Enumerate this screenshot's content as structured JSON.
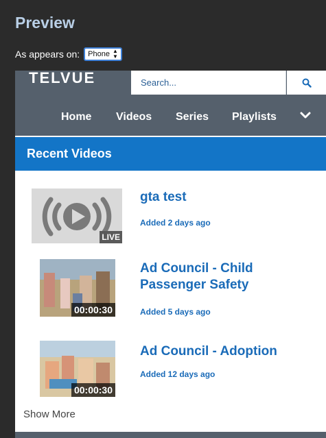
{
  "header": {
    "title": "Preview"
  },
  "device": {
    "label": "As appears on:",
    "selected": "Phone"
  },
  "site": {
    "logo": "TELVUE",
    "search_placeholder": "Search...",
    "nav": [
      "Home",
      "Videos",
      "Series",
      "Playlists"
    ]
  },
  "section": {
    "title": "Recent Videos"
  },
  "videos": [
    {
      "title": "gta test",
      "added": "Added 2 days ago",
      "badge": "LIVE"
    },
    {
      "title": "Ad Council - Child Passenger Safety",
      "added": "Added 5 days ago",
      "badge": "00:00:30"
    },
    {
      "title": "Ad Council - Adoption",
      "added": "Added 12 days ago",
      "badge": "00:00:30"
    }
  ],
  "show_more": "Show More",
  "colors": {
    "accent": "#1375c7",
    "site_bar": "#55606c",
    "link": "#1a6bb8",
    "page_bg": "#2b2b2b"
  }
}
